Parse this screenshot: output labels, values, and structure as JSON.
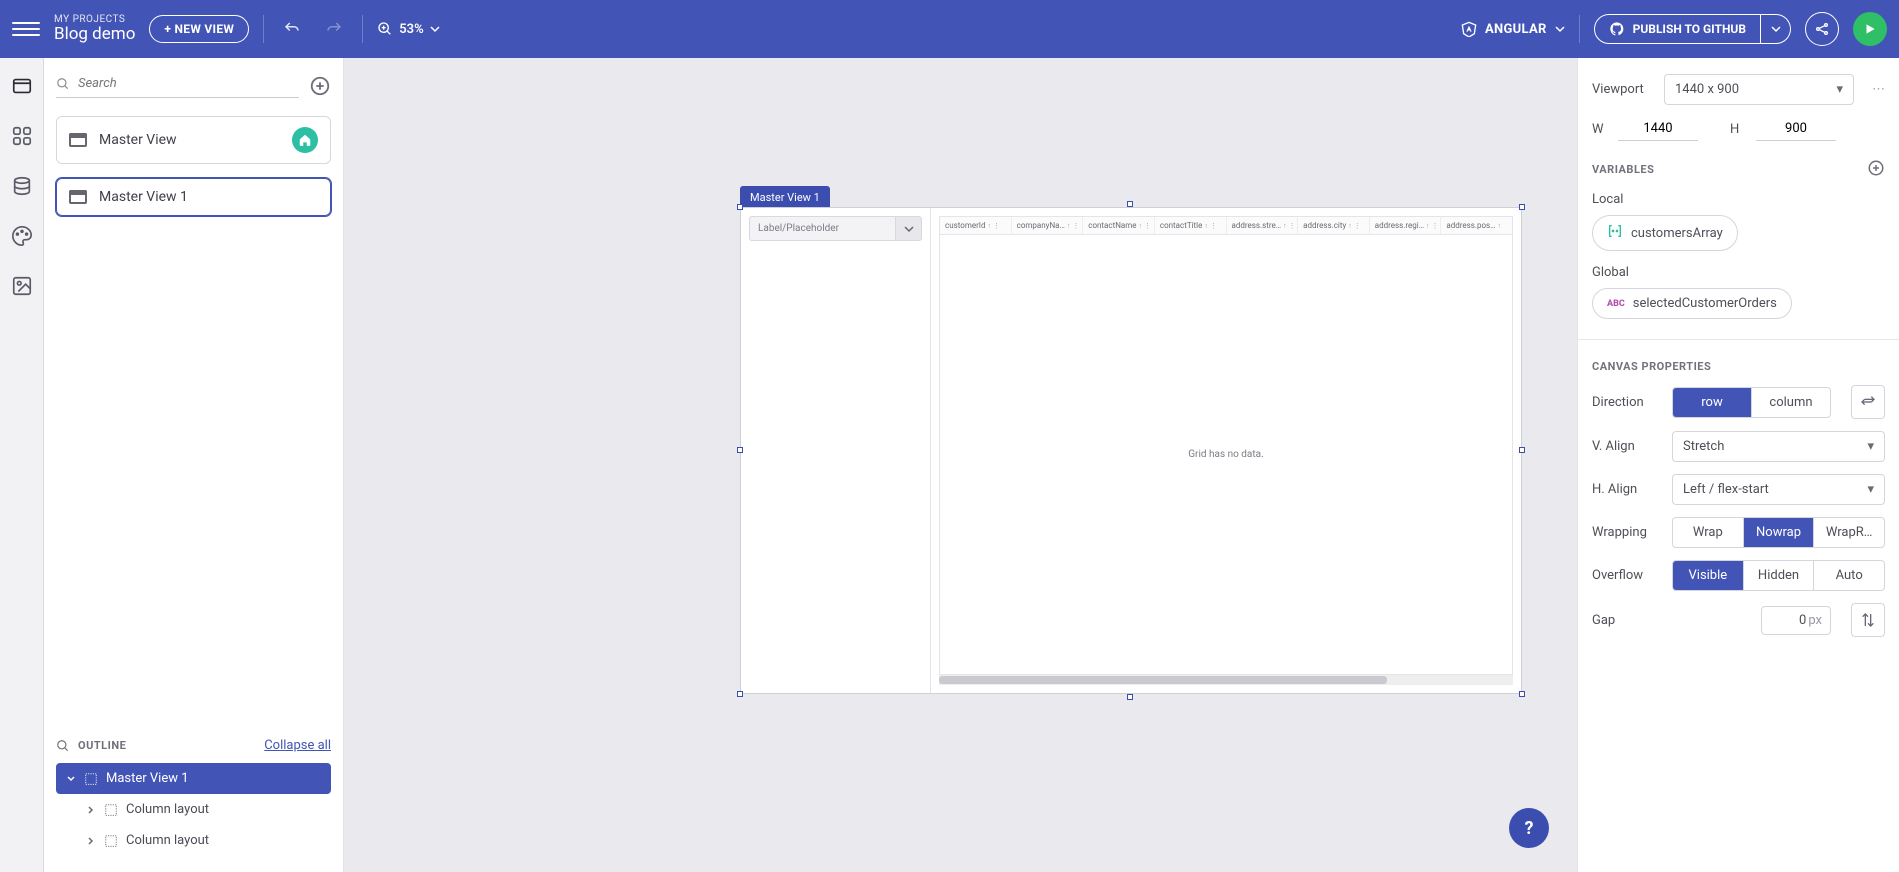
{
  "header": {
    "project_label": "MY PROJECTS",
    "project_name": "Blog demo",
    "new_view": "+ NEW VIEW",
    "zoom": "53%",
    "framework": "ANGULAR",
    "publish": "PUBLISH TO GITHUB"
  },
  "left": {
    "search_placeholder": "Search",
    "views": [
      "Master View",
      "Master View 1"
    ],
    "outline_label": "OUTLINE",
    "collapse": "Collapse all",
    "tree": {
      "root": "Master View 1",
      "children": [
        "Column layout",
        "Column layout"
      ]
    }
  },
  "canvas": {
    "frame_label": "Master View 1",
    "combo_placeholder": "Label/Placeholder",
    "grid_columns": [
      "customerId",
      "companyNa…",
      "contactName",
      "contactTitle",
      "address.stre…",
      "address.city",
      "address.regi…",
      "address.pos…"
    ],
    "grid_empty": "Grid has no data."
  },
  "right": {
    "viewport_label": "Viewport",
    "viewport_value": "1440 x 900",
    "W": "W",
    "W_val": "1440",
    "H": "H",
    "H_val": "900",
    "variables_label": "VARIABLES",
    "local_label": "Local",
    "local_var": "customersArray",
    "global_label": "Global",
    "global_var": "selectedCustomerOrders",
    "canvas_props_label": "CANVAS PROPERTIES",
    "direction_label": "Direction",
    "direction_opts": [
      "row",
      "column"
    ],
    "valign_label": "V. Align",
    "valign_val": "Stretch",
    "halign_label": "H. Align",
    "halign_val": "Left / flex-start",
    "wrapping_label": "Wrapping",
    "wrapping_opts": [
      "Wrap",
      "Nowrap",
      "WrapR…"
    ],
    "overflow_label": "Overflow",
    "overflow_opts": [
      "Visible",
      "Hidden",
      "Auto"
    ],
    "gap_label": "Gap",
    "gap_val": "0",
    "gap_unit": "px"
  },
  "help": "?"
}
